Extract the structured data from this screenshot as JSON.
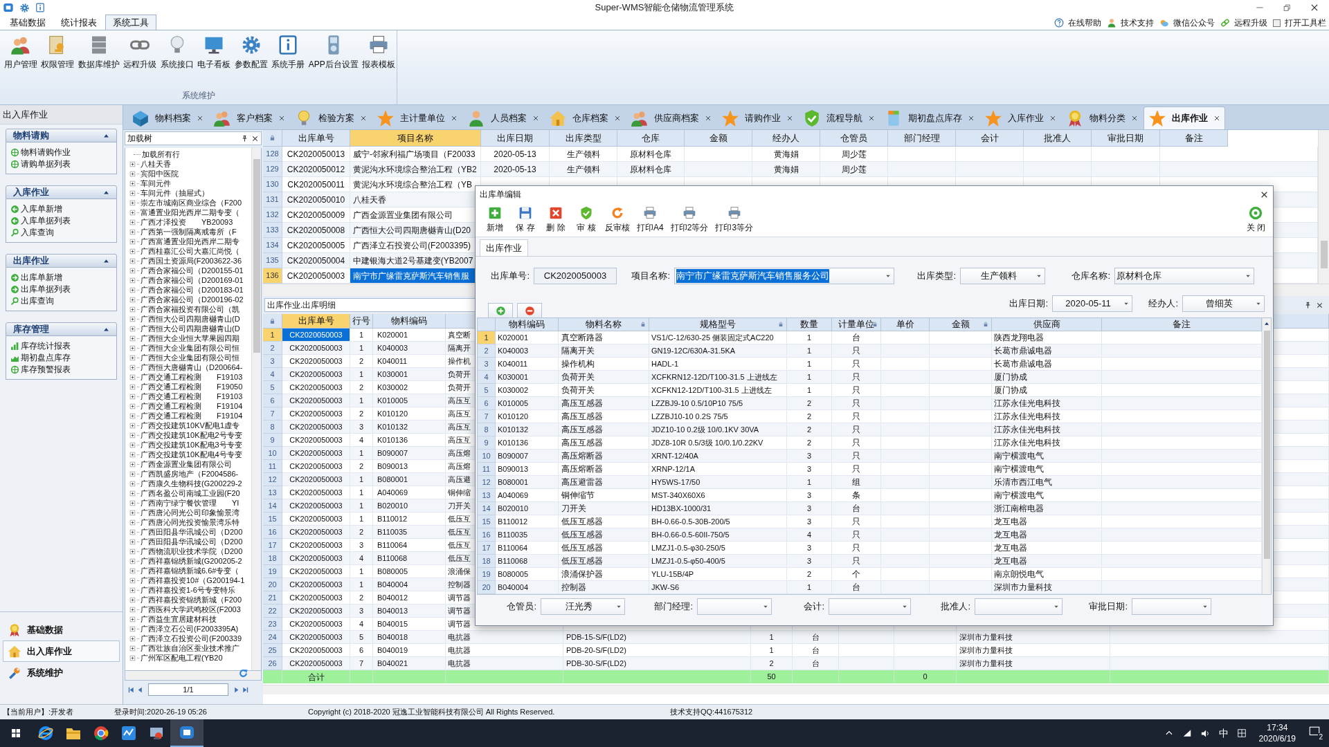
{
  "title_bar": {
    "title": "Super-WMS智能仓储物流管理系统"
  },
  "menu_tabs": [
    {
      "label": "基础数据",
      "selected": false
    },
    {
      "label": "统计报表",
      "selected": false
    },
    {
      "label": "系统工具",
      "selected": true
    }
  ],
  "help_links": [
    "在线帮助",
    "技术支持",
    "微信公众号",
    "远程升级"
  ],
  "toolbar_toggle": {
    "label": "打开工具栏",
    "checked": false
  },
  "ribbon": {
    "buttons": [
      "用户管理",
      "权限管理",
      "数据库维护",
      "远程升级",
      "系统接口",
      "电子看板",
      "参数配置",
      "系统手册",
      "APP后台设置",
      "报表模板"
    ],
    "group_label": "系统维护"
  },
  "left_panel": {
    "title": "出入库作业",
    "groups": [
      {
        "title": "物料请购",
        "expanded": true,
        "items": [
          "物料请购作业",
          "请购单据列表"
        ]
      },
      {
        "title": "入库作业",
        "expanded": true,
        "items": [
          "入库单新增",
          "入库单据列表",
          "入库查询"
        ]
      },
      {
        "title": "出库作业",
        "expanded": true,
        "items": [
          "出库单新增",
          "出库单据列表",
          "出库查询"
        ]
      },
      {
        "title": "库存管理",
        "expanded": true,
        "items": [
          "库存统计报表",
          "期初盘点库存",
          "库存预警报表"
        ]
      }
    ],
    "nav": [
      {
        "label": "基础数据",
        "selected": false
      },
      {
        "label": "出入库作业",
        "selected": true
      },
      {
        "label": "系统维护",
        "selected": false
      }
    ]
  },
  "doc_tabs": [
    {
      "label": "物料档案",
      "selected": false
    },
    {
      "label": "客户档案",
      "selected": false
    },
    {
      "label": "检验方案",
      "selected": false
    },
    {
      "label": "主计量单位",
      "selected": false
    },
    {
      "label": "人员档案",
      "selected": false
    },
    {
      "label": "仓库档案",
      "selected": false
    },
    {
      "label": "供应商档案",
      "selected": false
    },
    {
      "label": "请购作业",
      "selected": false
    },
    {
      "label": "流程导航",
      "selected": false
    },
    {
      "label": "期初盘点库存",
      "selected": false
    },
    {
      "label": "入库作业",
      "selected": false
    },
    {
      "label": "物料分类",
      "selected": false
    },
    {
      "label": "出库作业",
      "selected": true
    }
  ],
  "tree_panel": {
    "title": "加载树",
    "root": "加载所有行",
    "items": [
      {
        "label": "八桂天香",
        "expanded": false
      },
      {
        "label": "宾阳中医院",
        "expanded": false
      },
      {
        "label": "车间元件",
        "expanded": false
      },
      {
        "label": "车间元件（抽屉式）",
        "expanded": false
      },
      {
        "label": "崇左市城南区商业综合（F200",
        "expanded": false
      },
      {
        "label": "富通置业阳光西岸二期专变（",
        "expanded": false
      },
      {
        "label": "广西才泽投资　　YB20093",
        "expanded": false
      },
      {
        "label": "广西第一强制隔离戒毒所（F",
        "expanded": false
      },
      {
        "label": "广西富通置业阳光西岸二期专",
        "expanded": false
      },
      {
        "label": "广西桂嘉汇公司大嘉汇尚悦（",
        "expanded": false
      },
      {
        "label": "广西国土资源局(F2003622-36",
        "expanded": false
      },
      {
        "label": "广西合家福公司（D200155-01",
        "expanded": false
      },
      {
        "label": "广西合家福公司（D200169-01",
        "expanded": false
      },
      {
        "label": "广西合家福公司（D200183-01",
        "expanded": false
      },
      {
        "label": "广西合家福公司（D200196-02",
        "expanded": false
      },
      {
        "label": "广西合家福投资有限公司（凯",
        "expanded": false
      },
      {
        "label": "广西恒大公司四期唐樾青山(D",
        "expanded": false
      },
      {
        "label": "广西恒大公司四期唐樾青山(D",
        "expanded": false
      },
      {
        "label": "广西恒大企业恒大苹果园四期",
        "expanded": false
      },
      {
        "label": "广西恒大企业集团有限公司恒",
        "expanded": false
      },
      {
        "label": "广西恒大企业集团有限公司恒",
        "expanded": false
      },
      {
        "label": "广西恒大唐樾青山（D200664-",
        "expanded": false
      },
      {
        "label": "广西交通工程检测　　F19103",
        "expanded": false
      },
      {
        "label": "广西交通工程检测　　F19050",
        "expanded": false
      },
      {
        "label": "广西交通工程检测　　F19103",
        "expanded": false
      },
      {
        "label": "广西交通工程检测　　F19104",
        "expanded": false
      },
      {
        "label": "广西交通工程检测　　F19104",
        "expanded": false
      },
      {
        "label": "广西交投建筑10KV配电1虚专",
        "expanded": false
      },
      {
        "label": "广西交投建筑10K配电2号专变",
        "expanded": false
      },
      {
        "label": "广西交投建筑10K配电3号专变",
        "expanded": false
      },
      {
        "label": "广西交投建筑10K配电4号专变",
        "expanded": false
      },
      {
        "label": "广西金源置业集团有限公司",
        "expanded": false
      },
      {
        "label": "广西凯盛房地产（F2004586-",
        "expanded": false
      },
      {
        "label": "广西康久生物科技(G200229-2",
        "expanded": false
      },
      {
        "label": "广西名盈公司南城工业园(F20",
        "expanded": false
      },
      {
        "label": "广西南宁绿宁餐饮管理　　YI",
        "expanded": false
      },
      {
        "label": "广西唐沁同光公司印象愉景湾",
        "expanded": false
      },
      {
        "label": "广西唐沁同光投资愉景湾乐特",
        "expanded": false
      },
      {
        "label": "广西田阳县华讯城公司（D200",
        "expanded": false
      },
      {
        "label": "广西田阳县华讯城公司（D200",
        "expanded": false
      },
      {
        "label": "广西物流职业技术学院（D200",
        "expanded": false
      },
      {
        "label": "广西祥嘉锦绣新城(G200205-2",
        "expanded": false
      },
      {
        "label": "广西祥嘉锦绣新城6.6#专变（",
        "expanded": false
      },
      {
        "label": "广西祥嘉投资10#（G200194-1",
        "expanded": false
      },
      {
        "label": "广西祥嘉投资1-6号专变特乐",
        "expanded": false
      },
      {
        "label": "广西祥嘉投资锦绣新城（F200",
        "expanded": false
      },
      {
        "label": "广西医科大学武鸣校区(F2003",
        "expanded": false
      },
      {
        "label": "广西益生宜居建材科技",
        "expanded": false
      },
      {
        "label": "广西泽立石公司(F2003395A)",
        "expanded": false
      },
      {
        "label": "广西泽立石投资公司(F200339",
        "expanded": false
      },
      {
        "label": "广西壮族自治区蚕业技术推广",
        "expanded": false
      },
      {
        "label": "广州军区配电工程(YB20",
        "expanded": false
      }
    ],
    "pager": "1/1"
  },
  "master_table": {
    "columns": [
      {
        "label": "出库单号",
        "selected": false
      },
      {
        "label": "项目名称",
        "selected": true
      },
      {
        "label": "出库日期",
        "selected": false
      },
      {
        "label": "出库类型",
        "selected": false
      },
      {
        "label": "仓库",
        "selected": false
      },
      {
        "label": "金额",
        "selected": false
      },
      {
        "label": "经办人",
        "selected": false
      },
      {
        "label": "仓管员",
        "selected": false
      },
      {
        "label": "部门经理",
        "selected": false
      },
      {
        "label": "会计",
        "selected": false
      },
      {
        "label": "批准人",
        "selected": false
      },
      {
        "label": "审批日期",
        "selected": false
      },
      {
        "label": "备注",
        "selected": false
      }
    ],
    "rows": [
      {
        "index": "128",
        "selected": false,
        "order_no": "CK2020050013",
        "project": "威宁-邻家利福广场项目（F20033",
        "date": "2020-05-13",
        "type": "生产领料",
        "warehouse": "原材料仓库",
        "handler": "黄海娟",
        "keeper": "周少莲"
      },
      {
        "index": "129",
        "selected": false,
        "order_no": "CK2020050012",
        "project": "黄泥沟水环境综合整治工程（YB2",
        "date": "2020-05-13",
        "type": "生产领料",
        "warehouse": "原材料仓库",
        "handler": "黄海娟",
        "keeper": "周少莲"
      },
      {
        "index": "130",
        "selected": false,
        "order_no": "CK2020050011",
        "project": "黄泥沟水环境综合整治工程（YB"
      },
      {
        "index": "131",
        "selected": false,
        "order_no": "CK2020050010",
        "project": "八桂天香"
      },
      {
        "index": "132",
        "selected": false,
        "order_no": "CK2020050009",
        "project": "广西金源置业集团有限公司"
      },
      {
        "index": "133",
        "selected": false,
        "order_no": "CK2020050008",
        "project": "广西恒大公司四期唐樾青山(D20"
      },
      {
        "index": "134",
        "selected": false,
        "order_no": "CK2020050005",
        "project": "广西泽立石投资公司(F2003395)"
      },
      {
        "index": "135",
        "selected": false,
        "order_no": "CK2020050004",
        "project": "中建银海大道2号基建变(YB2007"
      },
      {
        "index": "136",
        "selected": true,
        "order_no": "CK2020050003",
        "project": "南宁市广缘雷克萨斯汽车销售服"
      }
    ]
  },
  "detail_label": "出库作业.出库明细",
  "detail_table": {
    "columns": [
      {
        "label": "出库单号",
        "selected": true
      },
      {
        "label": "行号",
        "selected": false
      },
      {
        "label": "物料编码",
        "selected": false
      }
    ],
    "rows": [
      {
        "index": "1",
        "selected": true,
        "order_no": "CK2020050003",
        "line_no": "1",
        "code": "K020001",
        "name": "真空断"
      },
      {
        "index": "2",
        "selected": false,
        "order_no": "CK2020050003",
        "line_no": "1",
        "code": "K040003",
        "name": "隔离开"
      },
      {
        "index": "3",
        "selected": false,
        "order_no": "CK2020050003",
        "line_no": "2",
        "code": "K040011",
        "name": "操作机"
      },
      {
        "index": "4",
        "selected": false,
        "order_no": "CK2020050003",
        "line_no": "1",
        "code": "K030001",
        "name": "负荷开"
      },
      {
        "index": "5",
        "selected": false,
        "order_no": "CK2020050003",
        "line_no": "2",
        "code": "K030002",
        "name": "负荷开"
      },
      {
        "index": "6",
        "selected": false,
        "order_no": "CK2020050003",
        "line_no": "1",
        "code": "K010005",
        "name": "高压互"
      },
      {
        "index": "7",
        "selected": false,
        "order_no": "CK2020050003",
        "line_no": "2",
        "code": "K010120",
        "name": "高压互"
      },
      {
        "index": "8",
        "selected": false,
        "order_no": "CK2020050003",
        "line_no": "3",
        "code": "K010132",
        "name": "高压互"
      },
      {
        "index": "9",
        "selected": false,
        "order_no": "CK2020050003",
        "line_no": "4",
        "code": "K010136",
        "name": "高压互"
      },
      {
        "index": "10",
        "selected": false,
        "order_no": "CK2020050003",
        "line_no": "1",
        "code": "B090007",
        "name": "高压熔"
      },
      {
        "index": "11",
        "selected": false,
        "order_no": "CK2020050003",
        "line_no": "2",
        "code": "B090013",
        "name": "高压熔"
      },
      {
        "index": "12",
        "selected": false,
        "order_no": "CK2020050003",
        "line_no": "1",
        "code": "B080001",
        "name": "高压避"
      },
      {
        "index": "13",
        "selected": false,
        "order_no": "CK2020050003",
        "line_no": "1",
        "code": "A040069",
        "name": "铜伸缩"
      },
      {
        "index": "14",
        "selected": false,
        "order_no": "CK2020050003",
        "line_no": "1",
        "code": "B020010",
        "name": "刀开关"
      },
      {
        "index": "15",
        "selected": false,
        "order_no": "CK2020050003",
        "line_no": "1",
        "code": "B110012",
        "name": "低压互"
      },
      {
        "index": "16",
        "selected": false,
        "order_no": "CK2020050003",
        "line_no": "2",
        "code": "B110035",
        "name": "低压互"
      },
      {
        "index": "17",
        "selected": false,
        "order_no": "CK2020050003",
        "line_no": "3",
        "code": "B110064",
        "name": "低压互"
      },
      {
        "index": "18",
        "selected": false,
        "order_no": "CK2020050003",
        "line_no": "4",
        "code": "B110068",
        "name": "低压互"
      },
      {
        "index": "19",
        "selected": false,
        "order_no": "CK2020050003",
        "line_no": "1",
        "code": "B080005",
        "name": "浪涌保"
      },
      {
        "index": "20",
        "selected": false,
        "order_no": "CK2020050003",
        "line_no": "1",
        "code": "B040004",
        "name": "控制器"
      },
      {
        "index": "21",
        "selected": false,
        "order_no": "CK2020050003",
        "line_no": "2",
        "code": "B040012",
        "name": "调节器"
      },
      {
        "index": "22",
        "selected": false,
        "order_no": "CK2020050003",
        "line_no": "3",
        "code": "B040013",
        "name": "调节器"
      },
      {
        "index": "23",
        "selected": false,
        "order_no": "CK2020050003",
        "line_no": "4",
        "code": "B040015",
        "name": "调节器"
      },
      {
        "index": "24",
        "selected": false,
        "order_no": "CK2020050003",
        "line_no": "5",
        "code": "B040018",
        "name": "电抗器",
        "spec": "PDB-15-S/F(LD2)",
        "qty": "1",
        "unit": "台",
        "supplier": "深圳市力量科技"
      },
      {
        "index": "25",
        "selected": false,
        "order_no": "CK2020050003",
        "line_no": "6",
        "code": "B040019",
        "name": "电抗器",
        "spec": "PDB-20-S/F(LD2)",
        "qty": "1",
        "unit": "台",
        "supplier": "深圳市力量科技"
      },
      {
        "index": "26",
        "selected": false,
        "order_no": "CK2020050003",
        "line_no": "7",
        "code": "B040021",
        "name": "电抗器",
        "spec": "PDB-30-S/F(LD2)",
        "qty": "2",
        "unit": "台",
        "supplier": "深圳市力量科技"
      }
    ],
    "total_row": {
      "label": "合计",
      "qty": "50",
      "amount": "0"
    }
  },
  "dialog": {
    "title": "出库单编辑",
    "toolbar": [
      "新增",
      "保 存",
      "删 除",
      "审 核",
      "反审核",
      "打印A4",
      "打印2等分",
      "打印3等分"
    ],
    "close_label": "关 闭",
    "tab": "出库作业",
    "fields": [
      {
        "label": "出库单号:",
        "value": "CK2020050003",
        "kind": "text",
        "selected": false
      },
      {
        "label": "项目名称:",
        "value": "南宁市广缘雷克萨斯汽车销售服务公司",
        "kind": "combo",
        "selected": true
      },
      {
        "label": "出库类型:",
        "value": "生产领料",
        "kind": "combo",
        "selected": false
      },
      {
        "label": "仓库名称:",
        "value": "原材料仓库",
        "kind": "combo",
        "selected": false
      },
      {
        "label": "出库日期:",
        "value": "2020-05-11",
        "kind": "combo",
        "selected": false
      },
      {
        "label": "经办人:",
        "value": "曾细英",
        "kind": "combo",
        "selected": false
      }
    ],
    "grid": {
      "columns": [
        {
          "label": "物料编码",
          "locked": false
        },
        {
          "label": "物料名称",
          "locked": true
        },
        {
          "label": "规格型号",
          "locked": true
        },
        {
          "label": "数量",
          "locked": false
        },
        {
          "label": "计量单位",
          "locked": true
        },
        {
          "label": "单价",
          "locked": false
        },
        {
          "label": "金额",
          "locked": true
        },
        {
          "label": "供应商",
          "locked": false
        },
        {
          "label": "备注",
          "locked": false
        }
      ],
      "rows": [
        {
          "index": "1",
          "selected": true,
          "code": "K020001",
          "name": "真空断路器",
          "spec": "VS1/C-12/630-25 侧装固定式AC220",
          "qty": "1",
          "unit": "台",
          "supplier": "陕西龙翔电器"
        },
        {
          "index": "2",
          "selected": false,
          "code": "K040003",
          "name": "隔离开关",
          "spec": "GN19-12C/630A-31.5KA",
          "qty": "1",
          "unit": "只",
          "supplier": "长葛市鼎诚电器"
        },
        {
          "index": "3",
          "selected": false,
          "code": "K040011",
          "name": "操作机构",
          "spec": "HADL-1",
          "qty": "1",
          "unit": "只",
          "supplier": "长葛市鼎诚电器"
        },
        {
          "index": "4",
          "selected": false,
          "code": "K030001",
          "name": "负荷开关",
          "spec": "XCFKRN12-12D/T100-31.5 上进线左",
          "qty": "1",
          "unit": "只",
          "supplier": "厦门协成"
        },
        {
          "index": "5",
          "selected": false,
          "code": "K030002",
          "name": "负荷开关",
          "spec": "XCFKN12-12D/T100-31.5 上进线左",
          "qty": "1",
          "unit": "只",
          "supplier": "厦门协成"
        },
        {
          "index": "6",
          "selected": false,
          "code": "K010005",
          "name": "高压互感器",
          "spec": "LZZBJ9-10  0.5/10P10  75/5",
          "qty": "2",
          "unit": "只",
          "supplier": "江苏永佳光电科技"
        },
        {
          "index": "7",
          "selected": false,
          "code": "K010120",
          "name": "高压互感器",
          "spec": "LZZBJ10-10  0.2S  75/5",
          "qty": "2",
          "unit": "只",
          "supplier": "江苏永佳光电科技"
        },
        {
          "index": "8",
          "selected": false,
          "code": "K010132",
          "name": "高压互感器",
          "spec": "JDZ10-10  0.2级  10/0.1KV 30VA",
          "qty": "2",
          "unit": "只",
          "supplier": "江苏永佳光电科技"
        },
        {
          "index": "9",
          "selected": false,
          "code": "K010136",
          "name": "高压互感器",
          "spec": "JDZ8-10R  0.5/3级  10/0.1/0.22KV",
          "qty": "2",
          "unit": "只",
          "supplier": "江苏永佳光电科技"
        },
        {
          "index": "10",
          "selected": false,
          "code": "B090007",
          "name": "高压熔断器",
          "spec": "XRNT-12/40A",
          "qty": "3",
          "unit": "只",
          "supplier": "南宁横渡电气"
        },
        {
          "index": "11",
          "selected": false,
          "code": "B090013",
          "name": "高压熔断器",
          "spec": "XRNP-12/1A",
          "qty": "3",
          "unit": "只",
          "supplier": "南宁横渡电气"
        },
        {
          "index": "12",
          "selected": false,
          "code": "B080001",
          "name": "高压避雷器",
          "spec": "HY5WS-17/50",
          "qty": "1",
          "unit": "组",
          "supplier": "乐清市西江电气"
        },
        {
          "index": "13",
          "selected": false,
          "code": "A040069",
          "name": "铜伸缩节",
          "spec": "MST-340X60X6",
          "qty": "3",
          "unit": "条",
          "supplier": "南宁横渡电气"
        },
        {
          "index": "14",
          "selected": false,
          "code": "B020010",
          "name": "刀开关",
          "spec": "HD13BX-1000/31",
          "qty": "3",
          "unit": "台",
          "supplier": "浙江南榕电器"
        },
        {
          "index": "15",
          "selected": false,
          "code": "B110012",
          "name": "低压互感器",
          "spec": "BH-0.66-0.5-30B-200/5",
          "qty": "3",
          "unit": "只",
          "supplier": "龙互电器"
        },
        {
          "index": "16",
          "selected": false,
          "code": "B110035",
          "name": "低压互感器",
          "spec": "BH-0.66-0.5-60II-750/5",
          "qty": "4",
          "unit": "只",
          "supplier": "龙互电器"
        },
        {
          "index": "17",
          "selected": false,
          "code": "B110064",
          "name": "低压互感器",
          "spec": "LMZJ1-0.5-φ30-250/5",
          "qty": "3",
          "unit": "只",
          "supplier": "龙互电器"
        },
        {
          "index": "18",
          "selected": false,
          "code": "B110068",
          "name": "低压互感器",
          "spec": "LMZJ1-0.5-φ50-400/5",
          "qty": "3",
          "unit": "只",
          "supplier": "龙互电器"
        },
        {
          "index": "19",
          "selected": false,
          "code": "B080005",
          "name": "浪涌保护器",
          "spec": "YLU-15B/4P",
          "qty": "2",
          "unit": "个",
          "supplier": "南京朗悦电气"
        },
        {
          "index": "20",
          "selected": false,
          "code": "B040004",
          "name": "控制器",
          "spec": "JKW-S6",
          "qty": "1",
          "unit": "台",
          "supplier": "深圳市力量科技"
        }
      ]
    },
    "footer_fields": [
      {
        "label": "仓管员:",
        "value": "汪光秀"
      },
      {
        "label": "部门经理:"
      },
      {
        "label": "会计:"
      },
      {
        "label": "批准人:"
      },
      {
        "label": "审批日期:"
      }
    ]
  },
  "status_bar": [
    "【当前用户】:开发者",
    "登录时间:2020-26-19 05:26",
    "Copyright (c) 2018-2020 冠逸工业智能科技有限公司 All Rights Reserved.",
    "技术支持QQ:441675312"
  ],
  "taskbar": {
    "ime": "中",
    "time": "17:34",
    "date": "2020/6/19",
    "notifications": "2"
  }
}
